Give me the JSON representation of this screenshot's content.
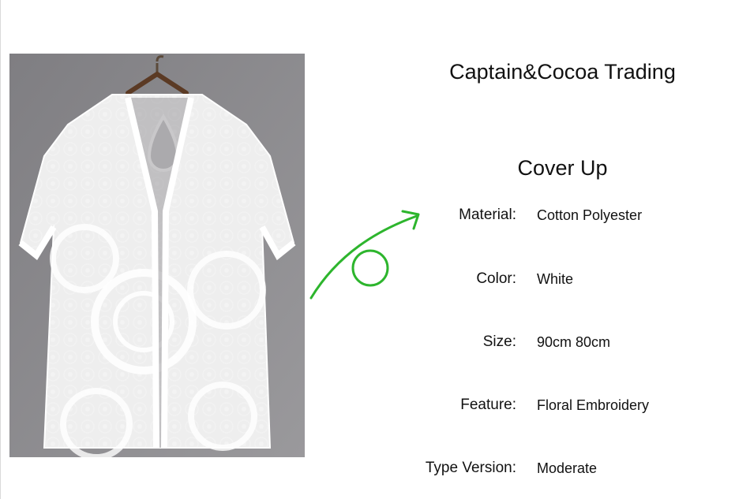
{
  "brand": {
    "name": "Captain&Cocoa Trading"
  },
  "product": {
    "title": "Cover Up"
  },
  "specs": [
    {
      "label": "Material:",
      "value": "Cotton Polyester"
    },
    {
      "label": "Color:",
      "value": "White"
    },
    {
      "label": "Size:",
      "value": "90cm 80cm"
    },
    {
      "label": "Feature:",
      "value": "Floral Embroidery"
    },
    {
      "label": "Type Version:",
      "value": "Moderate"
    }
  ],
  "colors": {
    "background": "#ffffff",
    "photo_background": "#8c8b8e",
    "arrow": "#2db52d",
    "text": "#111111"
  }
}
